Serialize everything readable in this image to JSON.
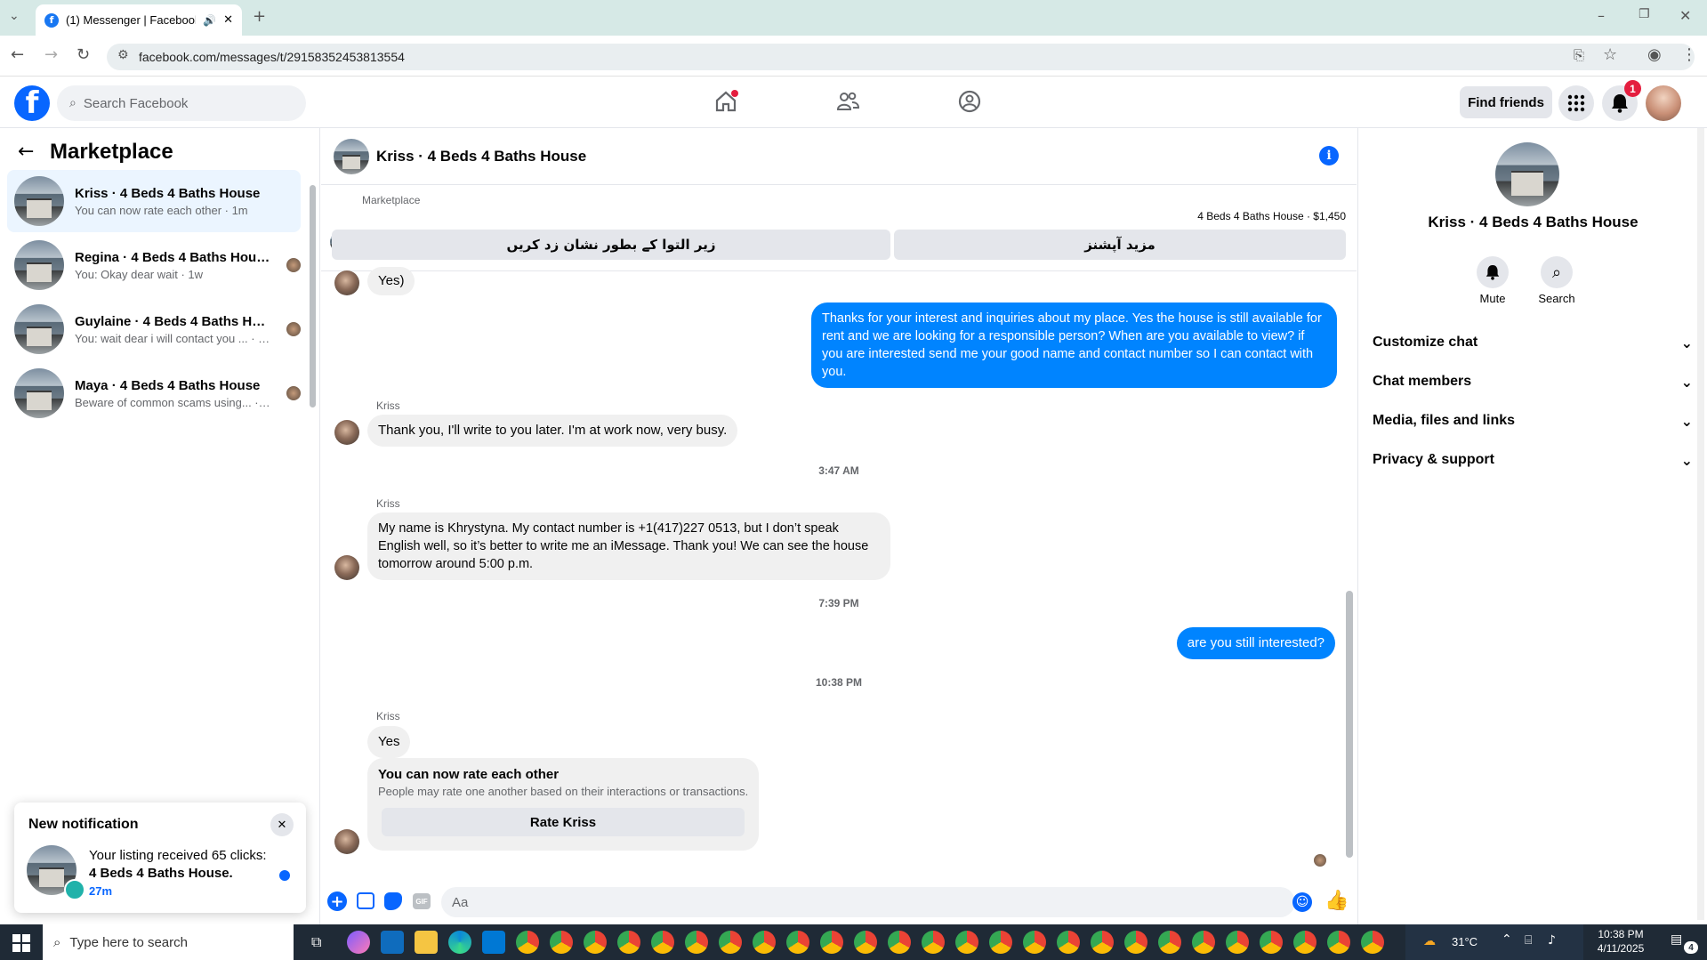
{
  "browser": {
    "tab_title": "(1) Messenger | Facebook",
    "url": "facebook.com/messages/t/29158352453813554"
  },
  "header": {
    "search_placeholder": "Search Facebook",
    "find_friends": "Find friends",
    "notif_count": "1"
  },
  "left": {
    "title": "Marketplace",
    "conversations": [
      {
        "name": "Kriss · 4 Beds 4 Baths House",
        "preview": "You can now rate each other · 1m"
      },
      {
        "name": "Regina · 4 Beds 4 Baths House",
        "preview": "You: Okay dear wait · 1w"
      },
      {
        "name": "Guylaine · 4 Beds 4 Baths Hou...",
        "preview": "You: wait dear i will contact you ... · 1w"
      },
      {
        "name": "Maya · 4 Beds 4 Baths House",
        "preview": "Beware of common scams using... · 1w"
      }
    ]
  },
  "notification": {
    "title": "New notification",
    "line1": "Your listing received 65 clicks:",
    "line2": "4 Beds 4 Baths House.",
    "time": "27m"
  },
  "chat": {
    "title": "Kriss · 4 Beds 4 Baths House",
    "marketplace_label": "Marketplace",
    "listing": "4 Beds 4 Baths House · $1,450",
    "btn_left": "زیر التوا کے بطور نشان زد کریں",
    "btn_right": "مزید آپشنز",
    "messages": {
      "m0": "Yes)",
      "m1": "Thanks for your interest and inquiries about my place. Yes the house is still available for rent and we are looking for a responsible person? When are you available to view? if you are interested send me your good name and contact number so I can contact with you.",
      "sender": "Kriss",
      "m2": "Thank you, I'll write to you later. I'm at work now, very busy.",
      "t1": "3:47 AM",
      "m3": "My name is Khrystyna. My contact number is +1(417)227 0513, but I don’t speak English  well, so it’s better to write me an iMessage. Thank you! We can see the house tomorrow around 5:00 p.m.",
      "t2": "7:39 PM",
      "m4": "are you still interested?",
      "t3": "10:38 PM",
      "m5": "Yes",
      "rate_title": "You can now rate each other",
      "rate_sub": "People may rate one another based on their interactions or transactions.",
      "rate_btn": "Rate Kriss"
    },
    "input_placeholder": "Aa"
  },
  "right": {
    "name": "Kriss · 4 Beds 4 Baths House",
    "mute": "Mute",
    "search": "Search",
    "sections": [
      "Customize chat",
      "Chat members",
      "Media, files and links",
      "Privacy & support"
    ]
  },
  "taskbar": {
    "search": "Type here to search",
    "temp": "31°C",
    "time": "10:38 PM",
    "date": "4/11/2025",
    "notif": "4"
  }
}
